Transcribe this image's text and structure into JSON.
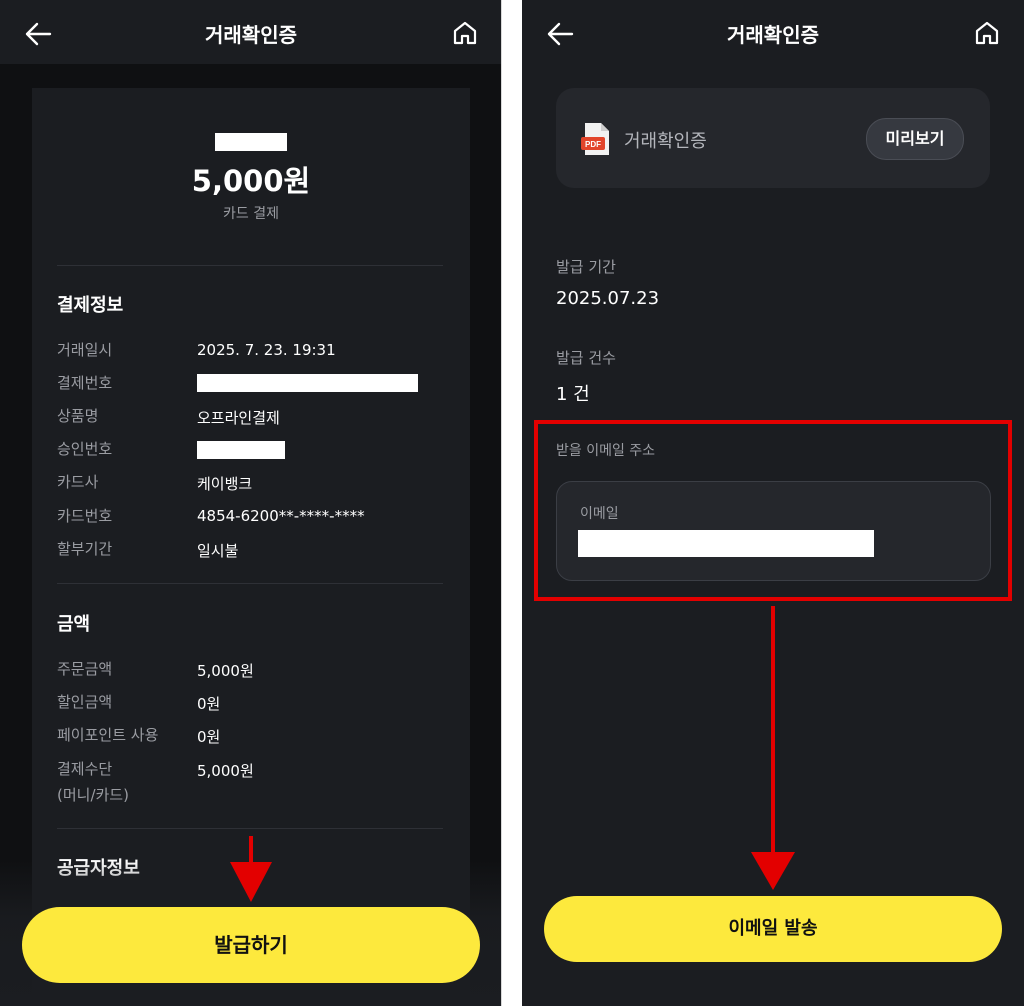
{
  "left": {
    "header": {
      "title": "거래확인증",
      "back_icon": "arrow-left-icon",
      "home_icon": "home-icon"
    },
    "summary": {
      "amount": "5,000원",
      "payment_type": "카드 결제"
    },
    "payment_info": {
      "title": "결제정보",
      "rows": [
        {
          "label": "거래일시",
          "value": "2025. 7. 23. 19:31"
        },
        {
          "label": "결제번호",
          "value": ""
        },
        {
          "label": "상품명",
          "value": "오프라인결제"
        },
        {
          "label": "승인번호",
          "value": ""
        },
        {
          "label": "카드사",
          "value": "케이뱅크"
        },
        {
          "label": "카드번호",
          "value": "4854-6200**-****-****"
        },
        {
          "label": "할부기간",
          "value": "일시불"
        }
      ]
    },
    "amount_info": {
      "title": "금액",
      "rows": [
        {
          "label": "주문금액",
          "value": "5,000원"
        },
        {
          "label": "할인금액",
          "value": "0원"
        },
        {
          "label": "페이포인트 사용",
          "value": "0원"
        },
        {
          "label": "결제수단",
          "label2": "(머니/카드)",
          "value": "5,000원"
        }
      ]
    },
    "supplier": {
      "title": "공급자정보"
    },
    "issue_button": "발급하기"
  },
  "right": {
    "header": {
      "title": "거래확인증",
      "back_icon": "arrow-left-icon",
      "home_icon": "home-icon"
    },
    "document": {
      "icon_text": "PDF",
      "name": "거래확인증",
      "preview_button": "미리보기"
    },
    "issue_period": {
      "label": "발급 기간",
      "value": "2025.07.23"
    },
    "issue_count": {
      "label": "발급 건수",
      "value": "1 건"
    },
    "email": {
      "section_label": "받을 이메일 주소",
      "field_label": "이메일",
      "value": ""
    },
    "send_button": "이메일 발송"
  },
  "colors": {
    "background": "#1b1d21",
    "accent_yellow": "#fde93d",
    "annotation_red": "#e30000"
  }
}
